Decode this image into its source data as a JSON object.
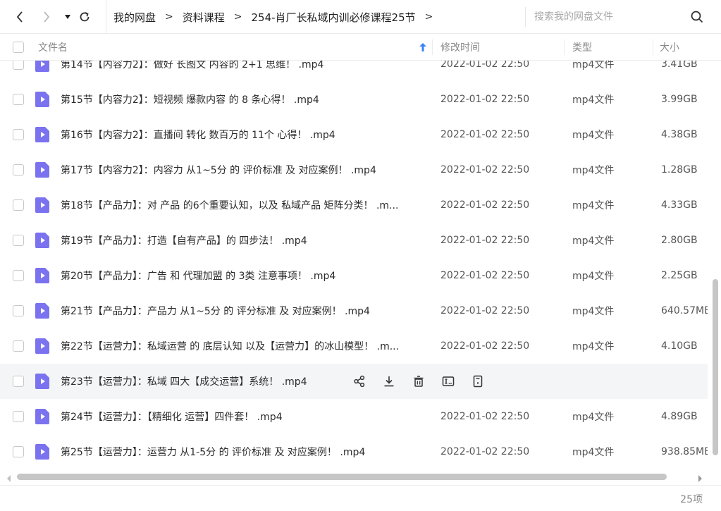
{
  "nav": {
    "back": "back-icon",
    "forward": "forward-icon",
    "dropdown": "caret-down-icon",
    "refresh": "refresh-icon"
  },
  "breadcrumb": {
    "items": [
      "我的网盘",
      "资料课程",
      "254-肖厂长私域内训必修课程25节"
    ],
    "separator": ">"
  },
  "search": {
    "placeholder": "搜索我的网盘文件"
  },
  "columns": {
    "name": "文件名",
    "mtime": "修改时间",
    "type": "类型",
    "size": "大小"
  },
  "files": [
    {
      "name": "第14节【内容力2】：做好 长图文 内容的 2+1 思维！ .mp4",
      "mtime": "2022-01-02 22:50",
      "type": "mp4文件",
      "size": "3.41GB"
    },
    {
      "name": "第15节【内容力2】：短视频 爆款内容 的 8 条心得！ .mp4",
      "mtime": "2022-01-02 22:50",
      "type": "mp4文件",
      "size": "3.99GB"
    },
    {
      "name": "第16节【内容力2】：直播间 转化 数百万的 11个 心得！ .mp4",
      "mtime": "2022-01-02 22:50",
      "type": "mp4文件",
      "size": "4.38GB"
    },
    {
      "name": "第17节【内容力2】：内容力 从1~5分 的 评价标准 及 对应案例！ .mp4",
      "mtime": "2022-01-02 22:50",
      "type": "mp4文件",
      "size": "1.28GB"
    },
    {
      "name": "第18节【产品力】：对 产品 的6个重要认知，以及 私域产品 矩阵分类！ .m...",
      "mtime": "2022-01-02 22:50",
      "type": "mp4文件",
      "size": "4.33GB"
    },
    {
      "name": "第19节【产品力】：打造【自有产品】的 四步法！ .mp4",
      "mtime": "2022-01-02 22:50",
      "type": "mp4文件",
      "size": "2.80GB"
    },
    {
      "name": "第20节【产品力】：广告 和 代理加盟 的 3类 注意事项！ .mp4",
      "mtime": "2022-01-02 22:50",
      "type": "mp4文件",
      "size": "2.25GB"
    },
    {
      "name": "第21节【产品力】：产品力 从1~5分 的 评分标准 及 对应案例！ .mp4",
      "mtime": "2022-01-02 22:50",
      "type": "mp4文件",
      "size": "640.57MB"
    },
    {
      "name": "第22节【运营力】：私域运营 的 底层认知 以及【运营力】的冰山模型！ .m...",
      "mtime": "2022-01-02 22:50",
      "type": "mp4文件",
      "size": "4.10GB"
    },
    {
      "name": "第23节【运营力】：私域 四大【成交运营】系统！ .mp4",
      "mtime": "",
      "type": "",
      "size": "",
      "hover": true
    },
    {
      "name": "第24节【运营力】：【精细化 运营】四件套！ .mp4",
      "mtime": "2022-01-02 22:50",
      "type": "mp4文件",
      "size": "4.89GB"
    },
    {
      "name": "第25节【运营力】：运营力 从1-5分 的 评价标准 及 对应案例！ .mp4",
      "mtime": "2022-01-02 22:50",
      "type": "mp4文件",
      "size": "938.85MB"
    }
  ],
  "row_actions": [
    "share-icon",
    "download-icon",
    "delete-icon",
    "rename-icon",
    "more-icon"
  ],
  "footer": {
    "count": "25项"
  },
  "colors": {
    "accent": "#3b82f6",
    "file_icon": "#7b72f0",
    "hover_row": "#f4f5f7"
  }
}
